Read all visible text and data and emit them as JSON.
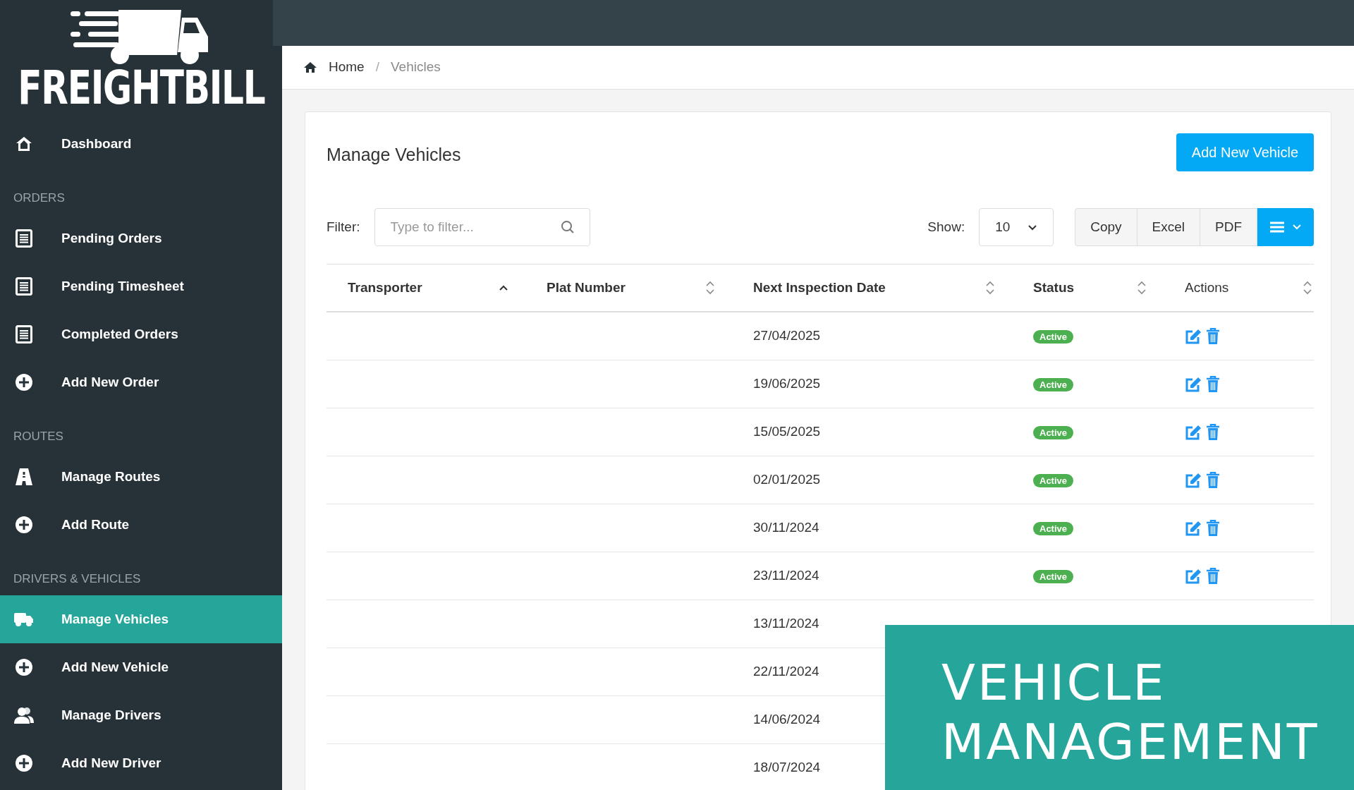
{
  "sidebar": {
    "logo_text": "FREIGHTBILL",
    "items": [
      {
        "kind": "link",
        "label": "Dashboard",
        "selected": false
      },
      {
        "kind": "section",
        "label": "ORDERS"
      },
      {
        "kind": "link",
        "label": "Pending Orders",
        "selected": false
      },
      {
        "kind": "link",
        "label": "Pending Timesheet",
        "selected": false
      },
      {
        "kind": "link",
        "label": "Completed Orders",
        "selected": false
      },
      {
        "kind": "link",
        "label": "Add New Order",
        "selected": false
      },
      {
        "kind": "section",
        "label": "ROUTES"
      },
      {
        "kind": "link",
        "label": "Manage Routes",
        "selected": false
      },
      {
        "kind": "link",
        "label": "Add Route",
        "selected": false
      },
      {
        "kind": "section",
        "label": "DRIVERS & VEHICLES"
      },
      {
        "kind": "link",
        "label": "Manage Vehicles",
        "selected": true
      },
      {
        "kind": "link",
        "label": "Add New Vehicle",
        "selected": false
      },
      {
        "kind": "link",
        "label": "Manage Drivers",
        "selected": false
      },
      {
        "kind": "link",
        "label": "Add New Driver",
        "selected": false
      }
    ]
  },
  "breadcrumb": {
    "separator": "/",
    "items": [
      "Home",
      "Vehicles"
    ]
  },
  "card": {
    "title": "Manage Vehicles",
    "add_button": "Add New Vehicle",
    "filter_label": "Filter:",
    "filter": {
      "placeholder": "Type to filter..."
    },
    "show_label": "Show:",
    "show_value": "10",
    "export_buttons": [
      "Copy",
      "Excel",
      "PDF"
    ]
  },
  "table": {
    "columns": [
      {
        "label": "Transporter",
        "sorted": true
      },
      {
        "label": "Plat Number",
        "sorted": false
      },
      {
        "label": "Next Inspection Date",
        "sorted": false
      },
      {
        "label": "Status",
        "sorted": false
      },
      {
        "label": "Actions",
        "sorted": false
      }
    ],
    "rows": [
      {
        "next_inspection_date": "27/04/2025",
        "status": "Active"
      },
      {
        "next_inspection_date": "19/06/2025",
        "status": "Active"
      },
      {
        "next_inspection_date": "15/05/2025",
        "status": "Active"
      },
      {
        "next_inspection_date": "02/01/2025",
        "status": "Active"
      },
      {
        "next_inspection_date": "30/11/2024",
        "status": "Active"
      },
      {
        "next_inspection_date": "23/11/2024",
        "status": "Active"
      },
      {
        "next_inspection_date": "13/11/2024"
      },
      {
        "next_inspection_date": "22/11/2024"
      },
      {
        "next_inspection_date": "14/06/2024"
      },
      {
        "next_inspection_date": "18/07/2024"
      }
    ]
  },
  "banner": {
    "text": "VEHICLE MANAGEMENT"
  }
}
